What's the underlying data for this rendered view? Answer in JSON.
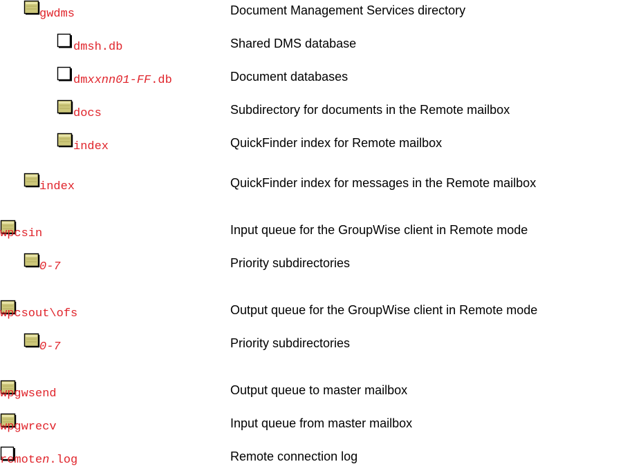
{
  "tree": [
    {
      "icon": "folder-icon",
      "name": [
        "gwdms"
      ],
      "italic": [
        false
      ],
      "desc": "Document Management Services directory"
    },
    {
      "icon": "file-icon",
      "name": [
        "dmsh.db"
      ],
      "italic": [
        false
      ],
      "desc": "Shared DMS database"
    },
    {
      "icon": "file-icon",
      "name": [
        "dm",
        "xxnn01-FF",
        ".db"
      ],
      "italic": [
        false,
        true,
        false
      ],
      "desc": "Document databases"
    },
    {
      "icon": "folder-icon",
      "name": [
        "docs"
      ],
      "italic": [
        false
      ],
      "desc": "Subdirectory for documents in the Remote mailbox"
    },
    {
      "icon": "folder-icon",
      "name": [
        "index"
      ],
      "italic": [
        false
      ],
      "desc": "QuickFinder index for Remote mailbox"
    },
    {
      "icon": "folder-icon",
      "name": [
        "index"
      ],
      "italic": [
        false
      ],
      "desc": "QuickFinder index for messages in the Remote mailbox"
    },
    {
      "icon": "folder-icon",
      "name": [
        "wpcsin"
      ],
      "italic": [
        false
      ],
      "desc": "Input queue for the GroupWise client in Remote mode"
    },
    {
      "icon": "folder-icon",
      "name": [
        "0-7"
      ],
      "italic": [
        true
      ],
      "desc": "Priority subdirectories"
    },
    {
      "icon": "folder-icon",
      "name": [
        "wpcsout\\ofs"
      ],
      "italic": [
        false
      ],
      "desc": "Output queue for the GroupWise client in Remote mode"
    },
    {
      "icon": "folder-icon",
      "name": [
        "0-7"
      ],
      "italic": [
        true
      ],
      "desc": "Priority subdirectories"
    },
    {
      "icon": "folder-icon",
      "name": [
        "wpgwsend"
      ],
      "italic": [
        false
      ],
      "desc": "Output queue to master mailbox"
    },
    {
      "icon": "folder-icon",
      "name": [
        "wpgwrecv"
      ],
      "italic": [
        false
      ],
      "desc": "Input queue from master mailbox"
    },
    {
      "icon": "file-icon",
      "name": [
        "remote",
        "n",
        ".log"
      ],
      "italic": [
        false,
        true,
        false
      ],
      "desc": "Remote connection log"
    }
  ],
  "colors": {
    "name": "#e0242b",
    "folder_fill": "#ccc77a",
    "folder_border": "#000000"
  }
}
